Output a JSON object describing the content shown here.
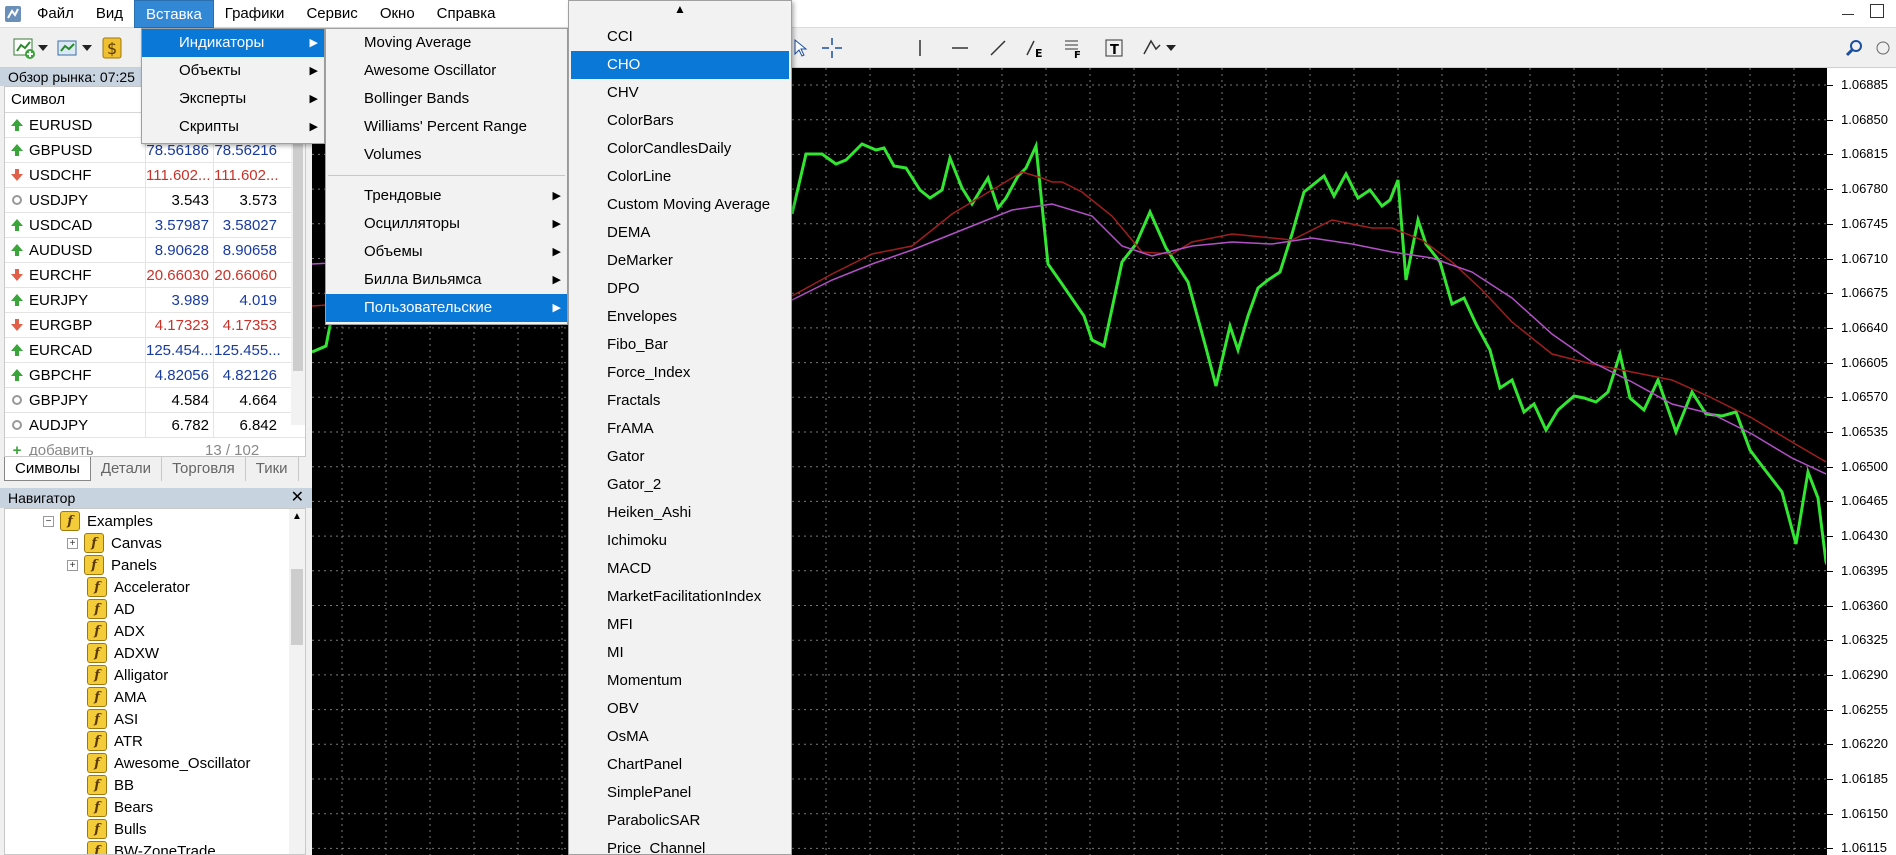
{
  "menubar": {
    "items": [
      "Файл",
      "Вид",
      "Вставка",
      "Графики",
      "Сервис",
      "Окно",
      "Справка"
    ],
    "active": "Вставка"
  },
  "market_watch": {
    "title": "Обзор рынка: 07:25",
    "col_symbol": "Символ",
    "rows": [
      {
        "symbol": "EURUSD",
        "bid": "",
        "ask": "",
        "dir": "up",
        "color": "blk"
      },
      {
        "symbol": "GBPUSD",
        "bid": "78.56186",
        "ask": "78.56216",
        "dir": "up",
        "color": "blue"
      },
      {
        "symbol": "USDCHF",
        "bid": "111.602...",
        "ask": "111.602...",
        "dir": "down",
        "color": "red"
      },
      {
        "symbol": "USDJPY",
        "bid": "3.543",
        "ask": "3.573",
        "dir": "none",
        "color": "blk"
      },
      {
        "symbol": "USDCAD",
        "bid": "3.57987",
        "ask": "3.58027",
        "dir": "up",
        "color": "blue"
      },
      {
        "symbol": "AUDUSD",
        "bid": "8.90628",
        "ask": "8.90658",
        "dir": "up",
        "color": "blue"
      },
      {
        "symbol": "EURCHF",
        "bid": "20.66030",
        "ask": "20.66060",
        "dir": "down",
        "color": "red"
      },
      {
        "symbol": "EURJPY",
        "bid": "3.989",
        "ask": "4.019",
        "dir": "up",
        "color": "blue"
      },
      {
        "symbol": "EURGBP",
        "bid": "4.17323",
        "ask": "4.17353",
        "dir": "down",
        "color": "red"
      },
      {
        "symbol": "EURCAD",
        "bid": "125.454...",
        "ask": "125.455...",
        "dir": "up",
        "color": "blue"
      },
      {
        "symbol": "GBPCHF",
        "bid": "4.82056",
        "ask": "4.82126",
        "dir": "up",
        "color": "blue"
      },
      {
        "symbol": "GBPJPY",
        "bid": "4.584",
        "ask": "4.664",
        "dir": "none",
        "color": "blk"
      },
      {
        "symbol": "AUDJPY",
        "bid": "6.782",
        "ask": "6.842",
        "dir": "none",
        "color": "blk"
      }
    ],
    "add_label": "добавить",
    "count": "13 / 102",
    "tabs": [
      "Символы",
      "Детали",
      "Торговля",
      "Тики"
    ]
  },
  "navigator": {
    "title": "Навигатор",
    "close": "✕",
    "items": [
      {
        "label": "Examples",
        "level": 0,
        "pm": "−"
      },
      {
        "label": "Canvas",
        "level": 1,
        "pm": "+"
      },
      {
        "label": "Panels",
        "level": 1,
        "pm": "+"
      },
      {
        "label": "Accelerator",
        "level": 1,
        "pm": ""
      },
      {
        "label": "AD",
        "level": 1,
        "pm": ""
      },
      {
        "label": "ADX",
        "level": 1,
        "pm": ""
      },
      {
        "label": "ADXW",
        "level": 1,
        "pm": ""
      },
      {
        "label": "Alligator",
        "level": 1,
        "pm": ""
      },
      {
        "label": "AMA",
        "level": 1,
        "pm": ""
      },
      {
        "label": "ASI",
        "level": 1,
        "pm": ""
      },
      {
        "label": "ATR",
        "level": 1,
        "pm": ""
      },
      {
        "label": "Awesome_Oscillator",
        "level": 1,
        "pm": ""
      },
      {
        "label": "BB",
        "level": 1,
        "pm": ""
      },
      {
        "label": "Bears",
        "level": 1,
        "pm": ""
      },
      {
        "label": "Bulls",
        "level": 1,
        "pm": ""
      },
      {
        "label": "BW-ZoneTrade",
        "level": 1,
        "pm": ""
      }
    ]
  },
  "insert_menu": {
    "items": [
      "Индикаторы",
      "Объекты",
      "Эксперты",
      "Скрипты"
    ],
    "highlighted": 0
  },
  "indicators_menu": {
    "top": [
      "Moving Average",
      "Awesome Oscillator",
      "Bollinger Bands",
      "Williams' Percent Range",
      "Volumes"
    ],
    "groups": [
      "Трендовые",
      "Осцилляторы",
      "Объемы",
      "Билла Вильямса",
      "Пользовательские"
    ],
    "highlighted": "Пользовательские"
  },
  "custom_menu": {
    "scroll_up": "▲",
    "items": [
      "CCI",
      "CHO",
      "CHV",
      "ColorBars",
      "ColorCandlesDaily",
      "ColorLine",
      "Custom Moving Average",
      "DEMA",
      "DeMarker",
      "DPO",
      "Envelopes",
      "Fibo_Bar",
      "Force_Index",
      "Fractals",
      "FrAMA",
      "Gator",
      "Gator_2",
      "Heiken_Ashi",
      "Ichimoku",
      "MACD",
      "MarketFacilitationIndex",
      "MFI",
      "MI",
      "Momentum",
      "OBV",
      "OsMA",
      "ChartPanel",
      "SimplePanel",
      "ParabolicSAR",
      "Price_Channel"
    ],
    "highlighted": "CHO"
  },
  "price_scale": {
    "labels": [
      "1.06885",
      "1.06850",
      "1.06815",
      "1.06780",
      "1.06745",
      "1.06710",
      "1.06675",
      "1.06640",
      "1.06605",
      "1.06570",
      "1.06535",
      "1.06500",
      "1.06465",
      "1.06430",
      "1.06395",
      "1.06360",
      "1.06325",
      "1.06290",
      "1.06255",
      "1.06220",
      "1.06185",
      "1.06150",
      "1.06115"
    ]
  },
  "colors": {
    "accent": "#0a78d7",
    "menu_active": "#3388d6",
    "price_line": "#32e632",
    "ma_red": "#a01e1e",
    "ma_violet": "#b450c8",
    "chart_bg": "#000000"
  }
}
